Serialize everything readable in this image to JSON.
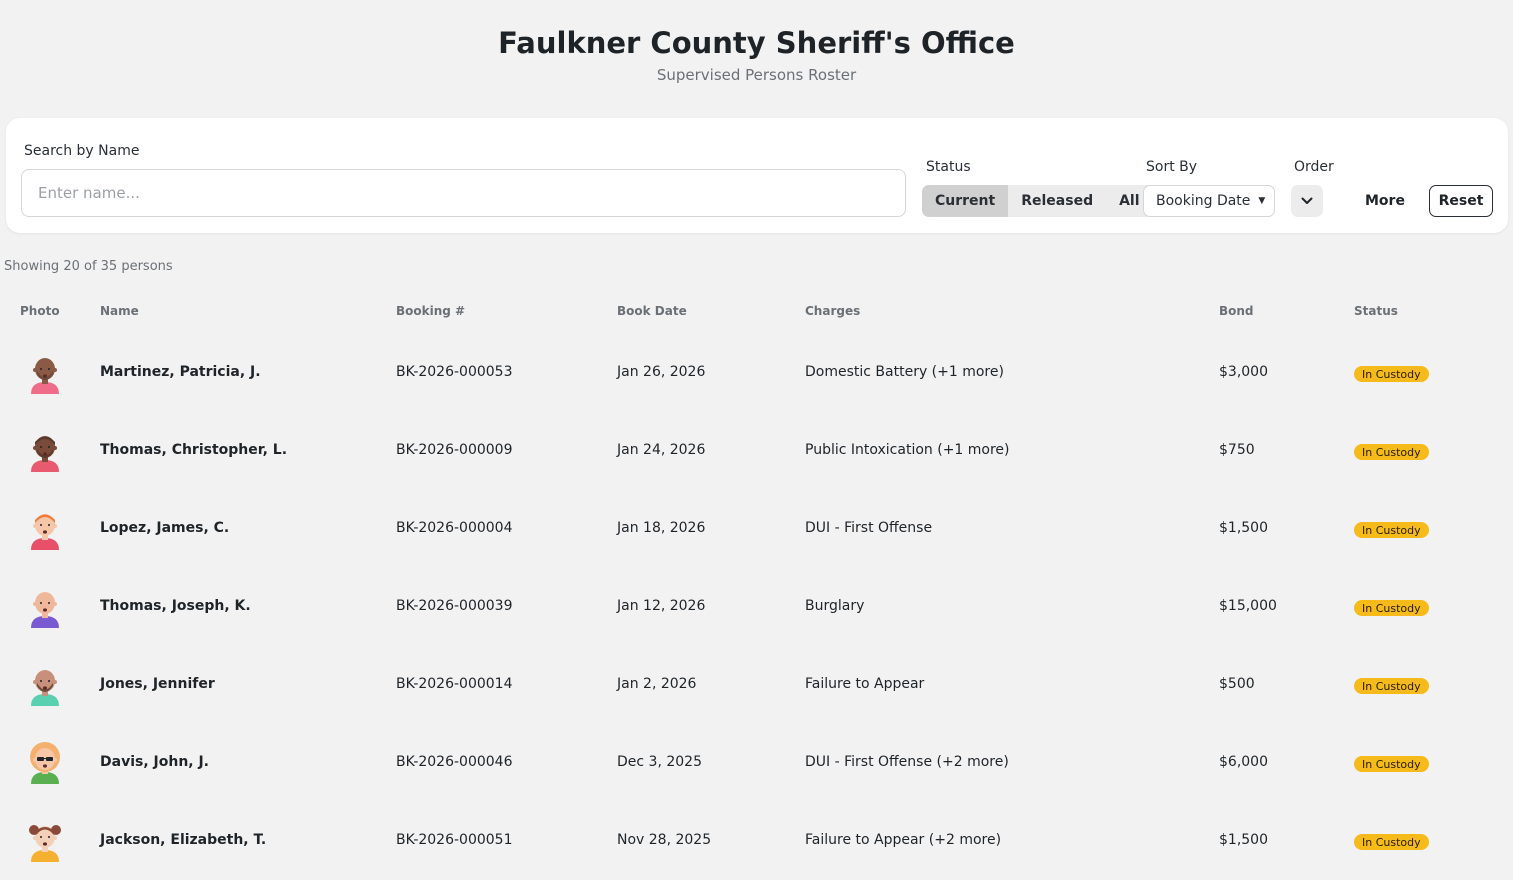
{
  "header": {
    "title": "Faulkner County Sheriff's Office",
    "subtitle": "Supervised Persons Roster"
  },
  "filters": {
    "search_label": "Search by Name",
    "search_placeholder": "Enter name...",
    "search_value": "",
    "status_label": "Status",
    "status_options": [
      "Current",
      "Released",
      "All"
    ],
    "status_selected": "Current",
    "sort_label": "Sort By",
    "sort_value": "Booking Date",
    "order_label": "Order",
    "more_label": "More",
    "reset_label": "Reset"
  },
  "count_text": "Showing 20 of 35 persons",
  "columns": {
    "photo": "Photo",
    "name": "Name",
    "booking": "Booking #",
    "date": "Book Date",
    "charges": "Charges",
    "bond": "Bond",
    "status": "Status"
  },
  "rows": [
    {
      "name": "Martinez, Patricia, J.",
      "booking": "BK-2026-000053",
      "date": "Jan 26, 2026",
      "charges": "Domestic Battery (+1 more)",
      "bond": "$3,000",
      "status": "In Custody",
      "avatar": {
        "skin": "#8a5a44",
        "hair": "#6b4a3a",
        "shirt": "#f06d8a",
        "style": "bald-beard"
      }
    },
    {
      "name": "Thomas, Christopher, L.",
      "booking": "BK-2026-000009",
      "date": "Jan 24, 2026",
      "charges": "Public Intoxication (+1 more)",
      "bond": "$750",
      "status": "In Custody",
      "avatar": {
        "skin": "#7a4a3a",
        "hair": "#5a3a2a",
        "shirt": "#e85a70",
        "style": "short-beard"
      }
    },
    {
      "name": "Lopez, James, C.",
      "booking": "BK-2026-000004",
      "date": "Jan 18, 2026",
      "charges": "DUI - First Offense",
      "bond": "$1,500",
      "status": "In Custody",
      "avatar": {
        "skin": "#f5c6a8",
        "hair": "#f07a3a",
        "shirt": "#e8506a",
        "style": "short"
      }
    },
    {
      "name": "Thomas, Joseph, K.",
      "booking": "BK-2026-000039",
      "date": "Jan 12, 2026",
      "charges": "Burglary",
      "bond": "$15,000",
      "status": "In Custody",
      "avatar": {
        "skin": "#f0b89a",
        "hair": "#f0b89a",
        "shirt": "#7a5ad0",
        "style": "bald"
      }
    },
    {
      "name": "Jones, Jennifer",
      "booking": "BK-2026-000014",
      "date": "Jan 2, 2026",
      "charges": "Failure to Appear",
      "bond": "$500",
      "status": "In Custody",
      "avatar": {
        "skin": "#c8907a",
        "hair": "#6b4a3a",
        "shirt": "#5ad0b0",
        "style": "bald-beard"
      }
    },
    {
      "name": "Davis, John, J.",
      "booking": "BK-2026-000046",
      "date": "Dec 3, 2025",
      "charges": "DUI - First Offense (+2 more)",
      "bond": "$6,000",
      "status": "In Custody",
      "avatar": {
        "skin": "#f5c6a8",
        "hair": "#f5b070",
        "shirt": "#5ab050",
        "style": "curly-glasses"
      }
    },
    {
      "name": "Jackson, Elizabeth, T.",
      "booking": "BK-2026-000051",
      "date": "Nov 28, 2025",
      "charges": "Failure to Appear (+2 more)",
      "bond": "$1,500",
      "status": "In Custody",
      "avatar": {
        "skin": "#f5d0b8",
        "hair": "#8a4a3a",
        "shirt": "#f5b030",
        "style": "pigtails"
      }
    }
  ],
  "colors": {
    "badge": "#f6bb1a",
    "background": "#f2f2f2",
    "card": "#ffffff"
  },
  "icons": {
    "order": "chevron-down-icon",
    "sort_caret": "caret-down-icon"
  }
}
